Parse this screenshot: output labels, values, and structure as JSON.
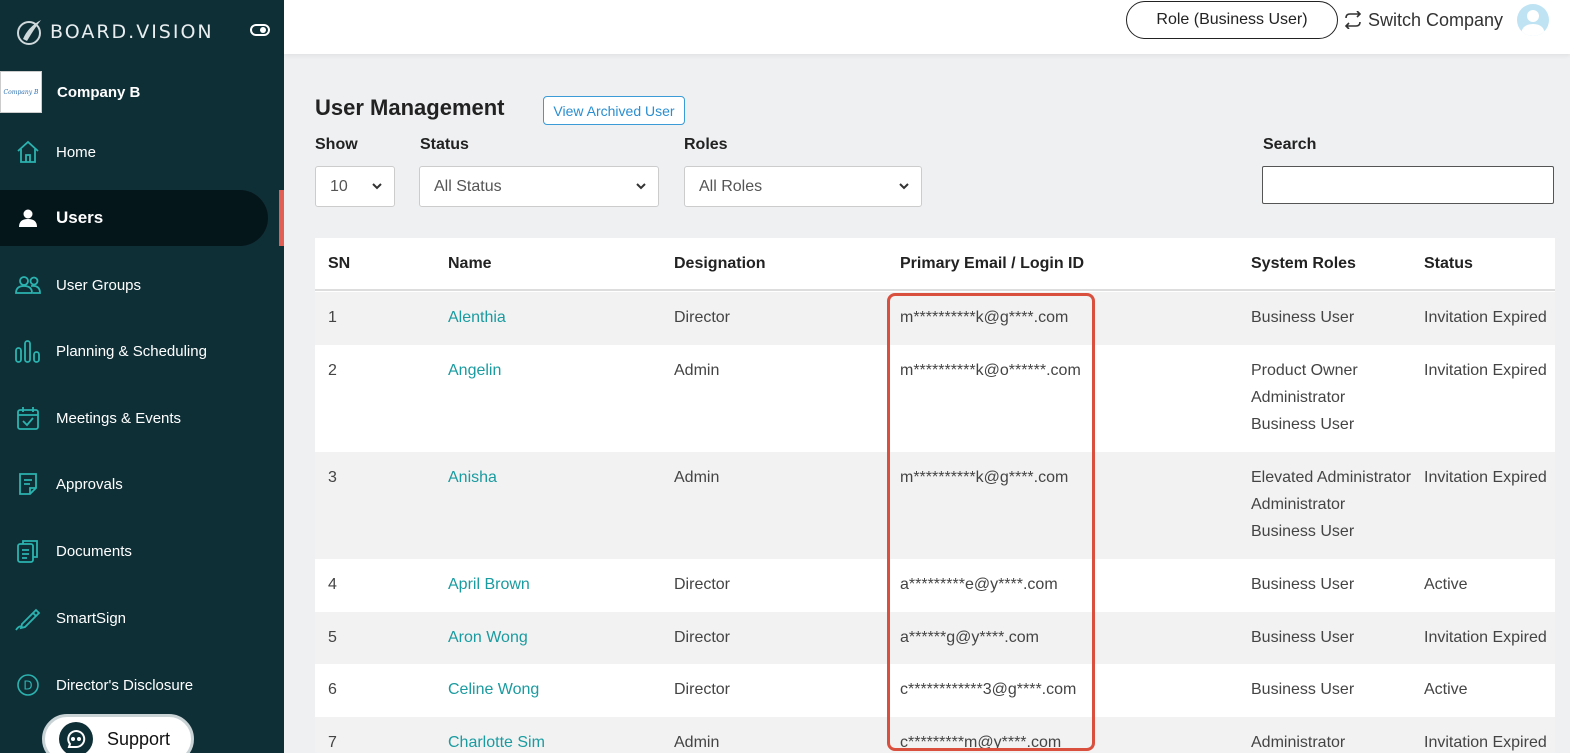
{
  "sidebar": {
    "logo_text": "BOARD.VISION",
    "company_logo_text": "Company B",
    "company_name": "Company B",
    "items": [
      {
        "label": "Home",
        "icon": "home-icon"
      },
      {
        "label": "Users",
        "icon": "user-icon"
      },
      {
        "label": "User Groups",
        "icon": "users-icon"
      },
      {
        "label": "Planning & Scheduling",
        "icon": "bars-icon"
      },
      {
        "label": "Meetings & Events",
        "icon": "calendar-check-icon"
      },
      {
        "label": "Approvals",
        "icon": "approval-icon"
      },
      {
        "label": "Documents",
        "icon": "documents-icon"
      },
      {
        "label": "SmartSign",
        "icon": "pen-icon"
      },
      {
        "label": "Director's Disclosure",
        "icon": "d-circle-icon"
      }
    ],
    "active_index": 1,
    "support_label": "Support"
  },
  "header": {
    "role_label": "Role (Business User)",
    "switch_company_label": "Switch Company"
  },
  "main": {
    "title": "User Management",
    "archived_button": "View Archived User",
    "filters": {
      "show_label": "Show",
      "show_value": "10",
      "status_label": "Status",
      "status_value": "All Status",
      "roles_label": "Roles",
      "roles_value": "All Roles",
      "search_label": "Search",
      "search_value": ""
    },
    "table": {
      "columns": [
        "SN",
        "Name",
        "Designation",
        "Primary Email / Login ID",
        "System Roles",
        "Status"
      ],
      "rows": [
        {
          "sn": "1",
          "name": "Alenthia",
          "designation": "Director",
          "email": "m**********k@g****.com",
          "roles": [
            "Business User"
          ],
          "status": "Invitation Expired"
        },
        {
          "sn": "2",
          "name": "Angelin",
          "designation": "Admin",
          "email": "m**********k@o******.com",
          "roles": [
            "Product Owner",
            "Administrator",
            "Business User"
          ],
          "status": "Invitation Expired"
        },
        {
          "sn": "3",
          "name": "Anisha",
          "designation": "Admin",
          "email": "m**********k@g****.com",
          "roles": [
            "Elevated Administrator",
            "Administrator",
            "Business User"
          ],
          "status": "Invitation Expired"
        },
        {
          "sn": "4",
          "name": "April Brown",
          "designation": "Director",
          "email": "a*********e@y****.com",
          "roles": [
            "Business User"
          ],
          "status": "Active"
        },
        {
          "sn": "5",
          "name": "Aron Wong",
          "designation": "Director",
          "email": "a******g@y****.com",
          "roles": [
            "Business User"
          ],
          "status": "Invitation Expired"
        },
        {
          "sn": "6",
          "name": "Celine Wong",
          "designation": "Director",
          "email": "c************3@g****.com",
          "roles": [
            "Business User"
          ],
          "status": "Active"
        },
        {
          "sn": "7",
          "name": "Charlotte Sim",
          "designation": "Admin",
          "email": "c*********m@y****.com",
          "roles": [
            "Administrator"
          ],
          "status": "Invitation Expired"
        }
      ]
    }
  }
}
